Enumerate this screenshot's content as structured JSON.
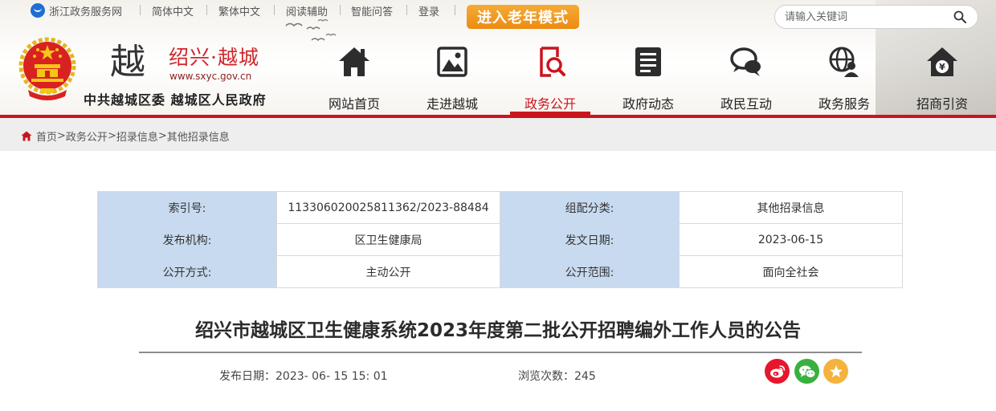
{
  "topbar": {
    "portal": "浙江政务服务网",
    "links": [
      "简体中文",
      "繁体中文",
      "阅读辅助",
      "智能问答",
      "登录"
    ],
    "elder_mode": "进入老年模式",
    "search_placeholder": "请输入关键词"
  },
  "logo": {
    "city": "绍兴·越城",
    "url": "www.sxyc.gov.cn",
    "org": "中共越城区委 越城区人民政府"
  },
  "nav": {
    "items": [
      {
        "label": "网站首页",
        "icon": "home-icon"
      },
      {
        "label": "走进越城",
        "icon": "picture-icon"
      },
      {
        "label": "政务公开",
        "icon": "search-document-icon",
        "active": true
      },
      {
        "label": "政府动态",
        "icon": "news-icon"
      },
      {
        "label": "政民互动",
        "icon": "chat-icon"
      },
      {
        "label": "政务服务",
        "icon": "globe-user-icon"
      },
      {
        "label": "招商引资",
        "icon": "money-house-icon"
      }
    ]
  },
  "breadcrumb": {
    "items": [
      "首页",
      "政务公开",
      "招录信息",
      "其他招录信息"
    ],
    "separator": ">"
  },
  "info": {
    "index_no_label": "索引号:",
    "index_no": "113306020025811362/2023-88484",
    "category_label": "组配分类:",
    "category": "其他招录信息",
    "publisher_label": "发布机构:",
    "publisher": "区卫生健康局",
    "date_label": "发文日期:",
    "date": "2023-06-15",
    "mode_label": "公开方式:",
    "mode": "主动公开",
    "scope_label": "公开范围:",
    "scope": "面向全社会"
  },
  "article": {
    "title": "绍兴市越城区卫生健康系统2023年度第二批公开招聘编外工作人员的公告",
    "publish_label": "发布日期：",
    "publish_date": "2023- 06- 15 15: 01",
    "views_label": "浏览次数：",
    "views": "245"
  },
  "colors": {
    "brand_red": "#c9151e",
    "elder_orange": "#f09a20",
    "table_key_bg": "#c8daef",
    "weibo": "#e6162d",
    "wechat": "#3ab03e",
    "favorite": "#f3b33d"
  }
}
